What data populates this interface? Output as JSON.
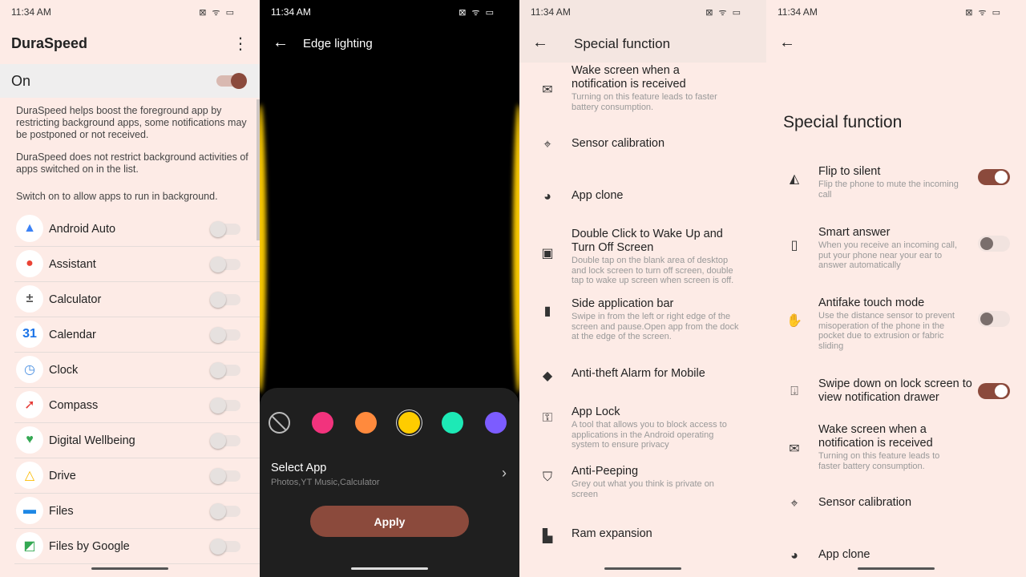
{
  "status": {
    "time": "11:34 AM",
    "icons": "⊠ ᯤ ▭"
  },
  "duraspeed": {
    "title": "DuraSpeed",
    "on_label": "On",
    "on_state": true,
    "desc1": "DuraSpeed helps boost the foreground app by restricting background apps, some notifications may be postponed or not received.",
    "desc2": "DuraSpeed does not restrict background activities of apps switched on in the list.",
    "desc3": "Switch on to allow apps to run in background.",
    "apps": [
      {
        "label": "Android Auto",
        "glyph": "▲",
        "color": "#3b82f6",
        "on": false
      },
      {
        "label": "Assistant",
        "glyph": "●",
        "color": "#ea4335",
        "on": false
      },
      {
        "label": "Calculator",
        "glyph": "±",
        "color": "#555",
        "on": false
      },
      {
        "label": "Calendar",
        "glyph": "31",
        "color": "#1a73e8",
        "on": false
      },
      {
        "label": "Clock",
        "glyph": "◷",
        "color": "#4a90e2",
        "on": false
      },
      {
        "label": "Compass",
        "glyph": "➚",
        "color": "#e53935",
        "on": false
      },
      {
        "label": "Digital Wellbeing",
        "glyph": "♥",
        "color": "#34a853",
        "on": false
      },
      {
        "label": "Drive",
        "glyph": "△",
        "color": "#fbbc04",
        "on": false
      },
      {
        "label": "Files",
        "glyph": "▬",
        "color": "#1e88e5",
        "on": false
      },
      {
        "label": "Files by Google",
        "glyph": "◩",
        "color": "#34a853",
        "on": false
      }
    ]
  },
  "edge": {
    "title": "Edge lighting",
    "colors": [
      "#f2337d",
      "#ff8a3d",
      "#ffcc00",
      "#1de9b6",
      "#7c5cff"
    ],
    "selected_color": "#ffcc00",
    "select_app": "Select App",
    "select_sub": "Photos,YT Music,Calculator",
    "apply": "Apply"
  },
  "special1": {
    "title": "Special function",
    "items": [
      {
        "icon": "mail-icon",
        "glyph": "✉",
        "title": "Wake screen when a notification is received",
        "sub": "Turning on this feature leads to faster battery consumption."
      },
      {
        "icon": "crosshair-icon",
        "glyph": "⌖",
        "title": "Sensor calibration",
        "sub": ""
      },
      {
        "icon": "app-clone-icon",
        "glyph": "◕",
        "title": "App clone",
        "sub": ""
      },
      {
        "icon": "double-tap-icon",
        "glyph": "▣",
        "title": "Double Click to Wake Up and Turn Off Screen",
        "sub": "Double tap on the blank area of desktop and lock screen to turn off screen, double tap to wake up screen when screen is off."
      },
      {
        "icon": "phone-icon",
        "glyph": "▮",
        "title": "Side application bar",
        "sub": "Swipe in from the left or right edge of the screen and pause.Open app from the dock at the edge of the screen."
      },
      {
        "icon": "alarm-icon",
        "glyph": "◆",
        "title": "Anti-theft Alarm for Mobile",
        "sub": ""
      },
      {
        "icon": "app-lock-icon",
        "glyph": "⚿",
        "title": "App Lock",
        "sub": "A tool that allows you to block access to applications in the Android operating system to ensure privacy"
      },
      {
        "icon": "shield-eye-icon",
        "glyph": "⛉",
        "title": "Anti-Peeping",
        "sub": "Grey out what you think is private on screen"
      },
      {
        "icon": "ram-icon",
        "glyph": "▙",
        "title": "Ram expansion",
        "sub": ""
      }
    ]
  },
  "special2": {
    "title": "Special function",
    "items": [
      {
        "icon": "flip-icon",
        "glyph": "◭",
        "title": "Flip to silent",
        "sub": "Flip the phone to mute the incoming call",
        "on": true
      },
      {
        "icon": "ear-phone-icon",
        "glyph": "▯",
        "title": "Smart answer",
        "sub": "When you receive an incoming call, put your phone near your ear to answer automatically",
        "on": false
      },
      {
        "icon": "hand-icon",
        "glyph": "✋",
        "title": "Antifake touch mode",
        "sub": "Use the distance sensor to prevent misoperation of the phone in the pocket due to extrusion or fabric sliding",
        "on": false
      },
      {
        "icon": "lock-screen-icon",
        "glyph": "⍗",
        "title": "Swipe down on lock screen to view notification drawer",
        "sub": "",
        "on": true
      },
      {
        "icon": "mail-icon",
        "glyph": "✉",
        "title": "Wake screen when a notification is received",
        "sub": "Turning on this feature leads to faster battery consumption."
      },
      {
        "icon": "crosshair-icon",
        "glyph": "⌖",
        "title": "Sensor calibration",
        "sub": ""
      },
      {
        "icon": "app-clone-icon",
        "glyph": "◕",
        "title": "App clone",
        "sub": ""
      }
    ]
  }
}
